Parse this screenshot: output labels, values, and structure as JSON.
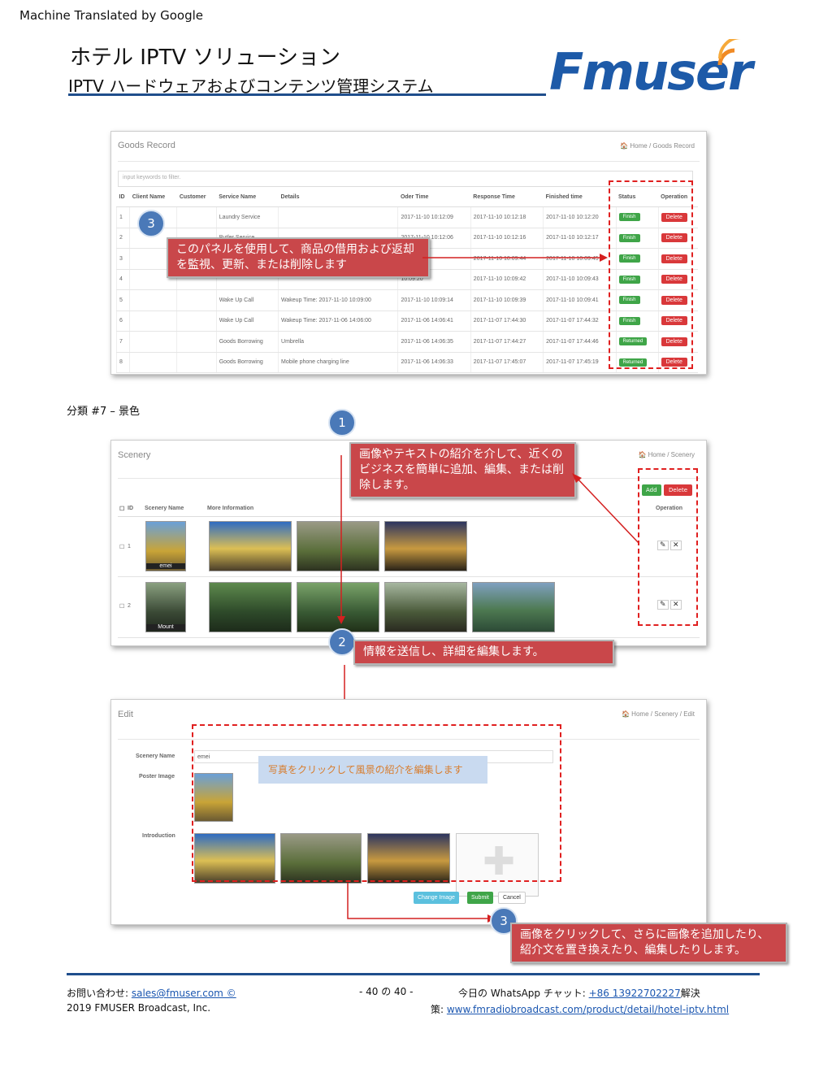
{
  "header": {
    "machine_translated": "Machine Translated by Google",
    "title": "ホテル IPTV ソリューション",
    "subtitle": "IPTV ハードウェアおよびコンテンツ管理システム",
    "logo_text": "Fmuser"
  },
  "goods_panel": {
    "title": "Goods Record",
    "breadcrumb": "🏠 Home / Goods Record",
    "filter_placeholder": "input keywords to filter.",
    "columns": [
      "ID",
      "Client Name",
      "Customer",
      "Service Name",
      "Details",
      "Oder Time",
      "Response Time",
      "Finished time",
      "Status",
      "Operation"
    ],
    "rows": [
      {
        "id": "1",
        "service": "Laundry Service",
        "details": "",
        "order": "2017-11-10 10:12:09",
        "response": "2017-11-10 10:12:18",
        "finished": "2017-11-10 10:12:20",
        "status": "Finish",
        "op": "Delete"
      },
      {
        "id": "2",
        "service": "Butler Service",
        "details": "",
        "order": "2017-11-10 10:12:06",
        "response": "2017-11-10 10:12:16",
        "finished": "2017-11-10 10:12:17",
        "status": "Finish",
        "op": "Delete"
      },
      {
        "id": "3",
        "service": "",
        "details": "",
        "order": "10:09:22",
        "response": "2017-11-10 10:09:44",
        "finished": "2017-11-10 10:09:45",
        "status": "Finish",
        "op": "Delete"
      },
      {
        "id": "4",
        "service": "",
        "details": "",
        "order": "10:09:20",
        "response": "2017-11-10 10:09:42",
        "finished": "2017-11-10 10:09:43",
        "status": "Finish",
        "op": "Delete"
      },
      {
        "id": "5",
        "service": "Wake Up Call",
        "details": "Wakeup Time: 2017-11-10 10:09:00",
        "order": "2017-11-10 10:09:14",
        "response": "2017-11-10 10:09:39",
        "finished": "2017-11-10 10:09:41",
        "status": "Finish",
        "op": "Delete"
      },
      {
        "id": "6",
        "service": "Wake Up Call",
        "details": "Wakeup Time: 2017-11-06 14:06:00",
        "order": "2017-11-06 14:06:41",
        "response": "2017-11-07 17:44:30",
        "finished": "2017-11-07 17:44:32",
        "status": "Finish",
        "op": "Delete"
      },
      {
        "id": "7",
        "service": "Goods Borrowing",
        "details": "Umbrella",
        "order": "2017-11-06 14:06:35",
        "response": "2017-11-07 17:44:27",
        "finished": "2017-11-07 17:44:46",
        "status": "Returned",
        "op": "Delete"
      },
      {
        "id": "8",
        "service": "Goods Borrowing",
        "details": "Mobile phone charging line",
        "order": "2017-11-06 14:06:33",
        "response": "2017-11-07 17:45:07",
        "finished": "2017-11-07 17:45:19",
        "status": "Returned",
        "op": "Delete"
      }
    ],
    "callout": "このパネルを使用して、商品の借用および返却を監視、更新、または削除します",
    "bubble": "3"
  },
  "category_label": "分類 #7 – 景色",
  "scenery_panel": {
    "title": "Scenery",
    "breadcrumb": "🏠 Home / Scenery",
    "add_label": "Add",
    "delete_label": "Delete",
    "columns": [
      "ID",
      "Scenery Name",
      "More Information",
      "Operation"
    ],
    "rows": [
      {
        "id": "1",
        "name": "emei"
      },
      {
        "id": "2",
        "name": "Mount"
      }
    ],
    "bubble1": "1",
    "callout1": "画像やテキストの紹介を介して、近くのビジネスを簡単に追加、編集、または削除します。",
    "bubble2": "2",
    "callout2": "情報を送信し、詳細を編集します。"
  },
  "edit_panel": {
    "title": "Edit",
    "breadcrumb": "🏠 Home / Scenery / Edit",
    "scenery_name_label": "Scenery Name",
    "scenery_name_value": "emei",
    "poster_label": "Poster Image",
    "intro_label": "Introduction",
    "hint": "写真をクリックして風景の紹介を編集します",
    "change_image": "Change Image",
    "submit": "Submit",
    "cancel": "Cancel",
    "bubble3": "3",
    "callout3": "画像をクリックして、さらに画像を追加したり、紹介文を置き換えたり、編集したりします。"
  },
  "footer": {
    "contact_prefix": "お問い合わせ: ",
    "email": "sales@fmuser.com ©",
    "copyright": "2019 FMUSER Broadcast, Inc.",
    "page": "- 40 の 40 -",
    "whatsapp_prefix": "今日の WhatsApp チャット: ",
    "phone": "+86 13922702227",
    "solution": "解決",
    "policy_prefix": "策: ",
    "url": "www.fmradiobroadcast.com/product/detail/hotel-iptv.html"
  },
  "colors": {
    "brand_blue": "#1d5aa8",
    "callout_red": "#c9474a",
    "finish_green": "#3fa548",
    "delete_red": "#d9383a",
    "bubble_blue": "#4a79b8"
  }
}
